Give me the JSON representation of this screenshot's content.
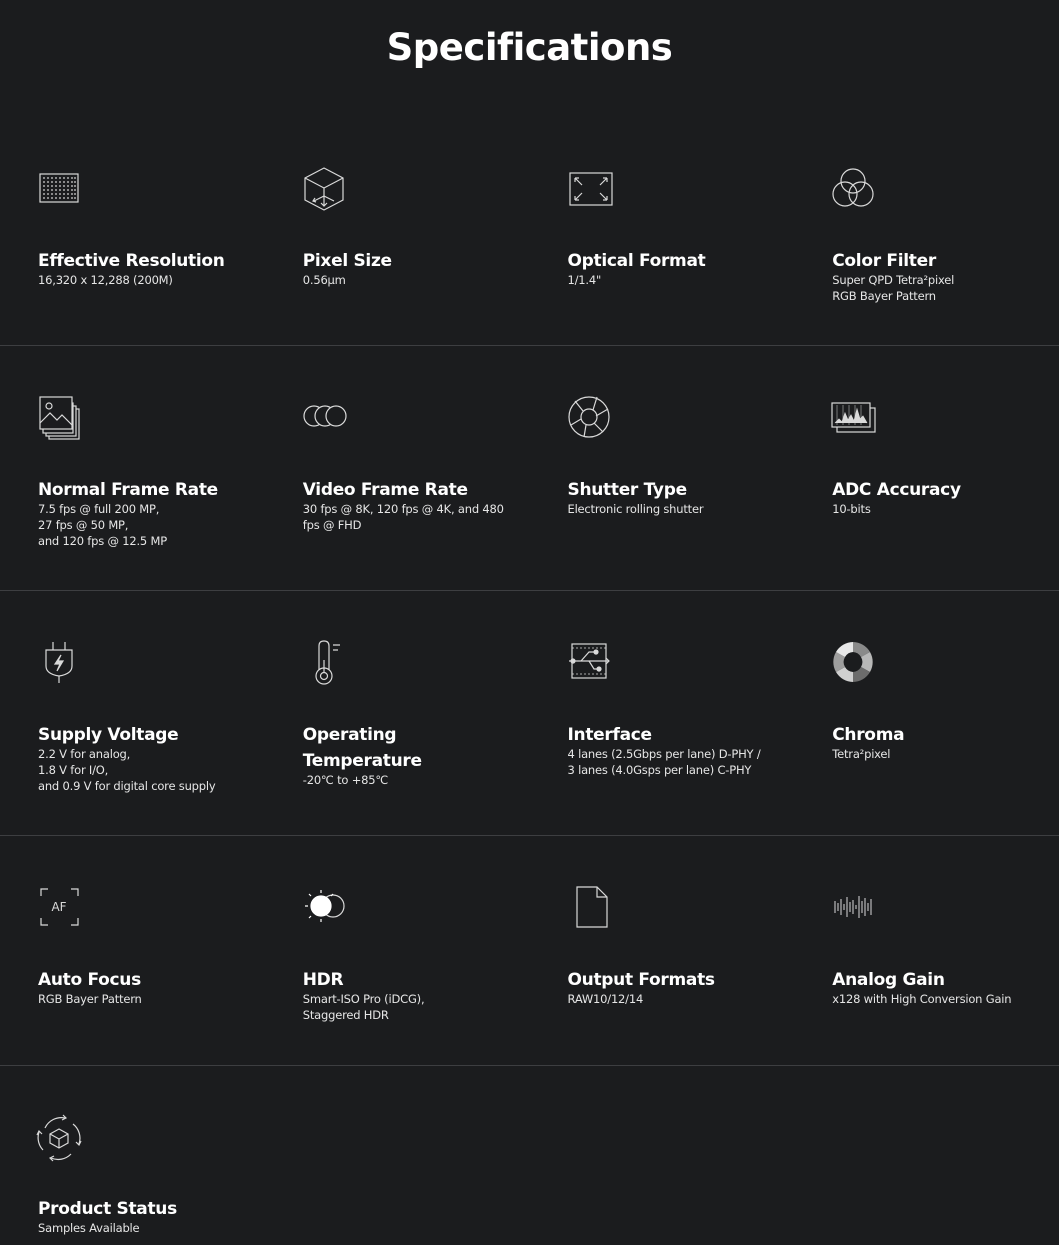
{
  "page": {
    "title": "Specifications",
    "colors": {
      "background": "#1b1c1e",
      "text": "#ffffff",
      "divider": "#3d3e41",
      "icon_stroke": "#d9d9d9"
    }
  },
  "specs": [
    {
      "icon": "grid-sensor-icon",
      "label": "Effective Resolution",
      "value": "16,320 x 12,288 (200M)"
    },
    {
      "icon": "pixel-cube-icon",
      "label": "Pixel Size",
      "value": "0.56µm"
    },
    {
      "icon": "expand-arrows-icon",
      "label": "Optical Format",
      "value": "1/1.4\""
    },
    {
      "icon": "rgb-circles-icon",
      "label": "Color Filter",
      "value": "Super QPD Tetra²pixel\nRGB Bayer Pattern"
    },
    {
      "icon": "image-stack-icon",
      "label": "Normal Frame Rate",
      "value": "7.5 fps @ full 200 MP,\n27 fps @ 50 MP,\nand 120 fps @ 12.5 MP"
    },
    {
      "icon": "triple-circle-icon",
      "label": "Video Frame Rate",
      "value": "30 fps @ 8K, 120 fps @ 4K, and 480\nfps @ FHD"
    },
    {
      "icon": "aperture-icon",
      "label": "Shutter Type",
      "value": "Electronic rolling shutter"
    },
    {
      "icon": "histogram-icon",
      "label": "ADC Accuracy",
      "value": "10-bits"
    },
    {
      "icon": "power-plug-icon",
      "label": "Supply Voltage",
      "value": "2.2 V for analog,\n1.8 V for I/O,\nand 0.9 V for digital core supply"
    },
    {
      "icon": "thermometer-icon",
      "label": "Operating\nTemperature",
      "value": "-20℃ to +85℃"
    },
    {
      "icon": "interface-circuit-icon",
      "label": "Interface",
      "value": "4 lanes (2.5Gbps per lane) D-PHY /\n3 lanes (4.0Gsps per lane) C-PHY"
    },
    {
      "icon": "chroma-ring-icon",
      "label": "Chroma",
      "value": "Tetra²pixel"
    },
    {
      "icon": "autofocus-icon",
      "label": "Auto Focus",
      "value": "RGB Bayer Pattern"
    },
    {
      "icon": "hdr-sun-icon",
      "label": "HDR",
      "value": "Smart-ISO Pro (iDCG),\nStaggered HDR"
    },
    {
      "icon": "document-icon",
      "label": "Output Formats",
      "value": "RAW10/12/14"
    },
    {
      "icon": "waveform-icon",
      "label": "Analog Gain",
      "value": "x128 with High Conversion Gain"
    },
    {
      "icon": "cycle-cube-icon",
      "label": "Product Status",
      "value": "Samples Available"
    }
  ],
  "icon_text": {
    "autofocus": "AF"
  }
}
